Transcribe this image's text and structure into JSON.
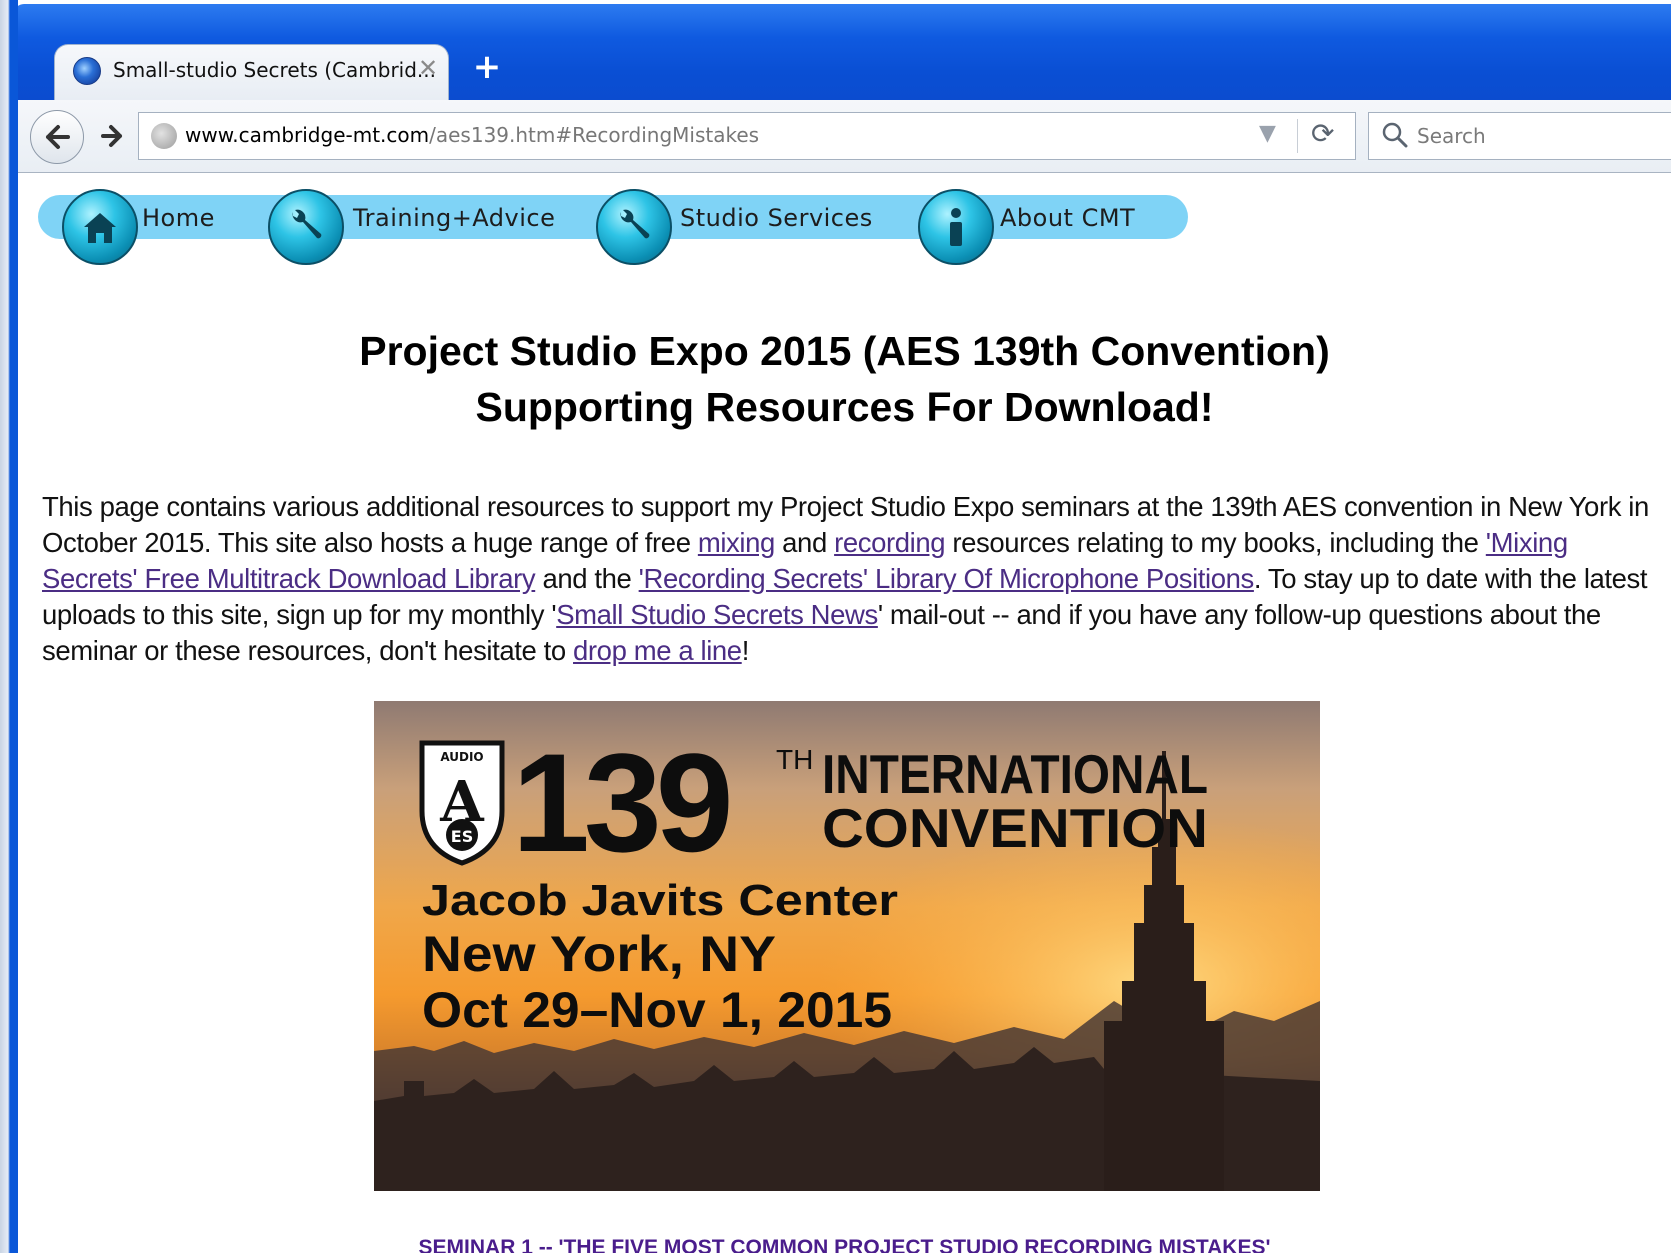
{
  "browser": {
    "tab_title": "Small-studio Secrets (Cambrid...",
    "tab_close": "✕",
    "new_tab": "+",
    "url_host": "www.cambridge-mt.com",
    "url_path": "/aes139.htm#RecordingMistakes",
    "search_placeholder": "Search"
  },
  "nav": {
    "items": [
      {
        "label": "Home",
        "icon": "home-icon"
      },
      {
        "label": "Training+Advice",
        "icon": "wrench-icon"
      },
      {
        "label": "Studio Services",
        "icon": "wrench-icon"
      },
      {
        "label": "About CMT",
        "icon": "info-icon"
      }
    ]
  },
  "page": {
    "heading_line1": "Project Studio Expo 2015 (AES 139th Convention)",
    "heading_line2": "Supporting Resources For Download!",
    "intro": {
      "t1": "This page contains various additional resources to support my Project Studio Expo seminars at the 139th AES convention in New York in October 2015. This site also hosts a huge range of free ",
      "link_mixing": "mixing",
      "t2": " and ",
      "link_recording": "recording",
      "t3": " resources relating to my books, including the ",
      "link_library": "'Mixing Secrets' Free Multitrack Download Library",
      "t4": " and the ",
      "link_mic": "'Recording Secrets' Library Of Microphone Positions",
      "t5": ". To stay up to date with the latest uploads to this site, sign up for my monthly '",
      "link_news": "Small Studio Secrets News",
      "t6": "' mail-out -- and if you have any follow-up questions about the seminar or these resources, don't hesitate to ",
      "link_contact": "drop me a line",
      "t7": "!"
    },
    "banner": {
      "number": "139",
      "th": "TH",
      "title1": "INTERNATIONAL",
      "title2": "CONVENTION",
      "line1": "Jacob Javits Center",
      "line2": "New York, NY",
      "line3": "Oct 29–Nov 1, 2015",
      "logo_top": "AUDIO",
      "logo_mid": "A",
      "logo_bottom": "ES"
    },
    "seminar_heading": "SEMINAR 1 -- 'THE FIVE MOST COMMON PROJECT STUDIO RECORDING MISTAKES'"
  }
}
